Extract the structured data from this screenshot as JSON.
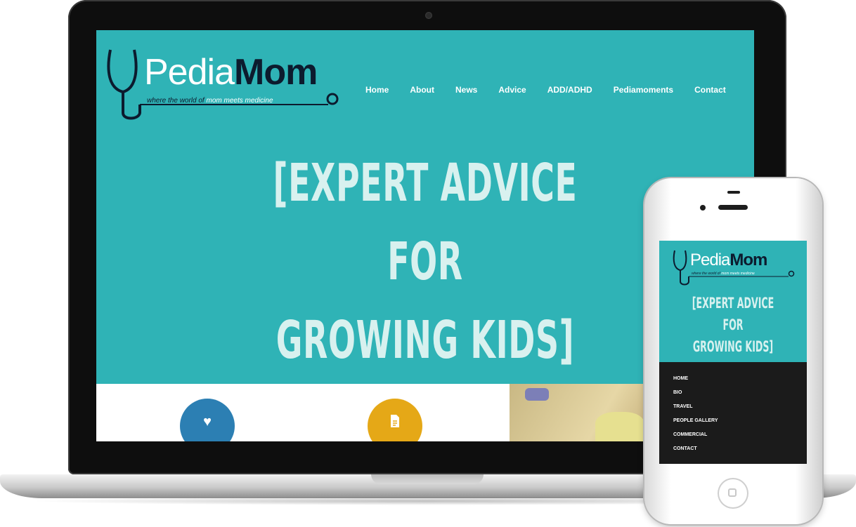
{
  "brand": {
    "name_part1": "Pedia",
    "name_part2": "Mom",
    "tagline_part1": "where the world of",
    "tagline_highlight": "mom meets medicine"
  },
  "nav": {
    "items": [
      "Home",
      "About",
      "News",
      "Advice",
      "ADD/ADHD",
      "Pediamoments",
      "Contact"
    ]
  },
  "hero": {
    "line1": "[EXPERT ADVICE",
    "line2": "FOR",
    "line3": "GROWING KIDS]"
  },
  "features": {
    "icon1": "heart-icon",
    "icon2": "document-icon"
  },
  "mobile_menu": {
    "items": [
      "HOME",
      "BIO",
      "TRAVEL",
      "PEOPLE GALLERY",
      "COMMERCIAL",
      "CONTACT"
    ]
  },
  "colors": {
    "teal": "#2fb3b6",
    "navy": "#0c1b2e",
    "blue_circle": "#2c7fb3",
    "gold_circle": "#e5a817"
  }
}
